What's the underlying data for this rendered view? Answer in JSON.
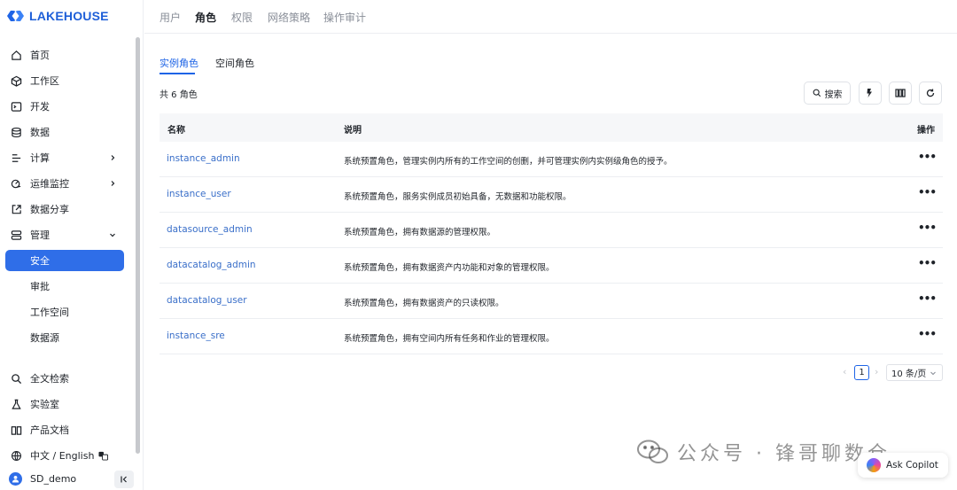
{
  "brand": {
    "name": "LAKEHOUSE"
  },
  "sidebar": {
    "items": [
      {
        "label": "首页",
        "icon": "home-icon"
      },
      {
        "label": "工作区",
        "icon": "cube-icon"
      },
      {
        "label": "开发",
        "icon": "terminal-icon"
      },
      {
        "label": "数据",
        "icon": "database-icon"
      },
      {
        "label": "计算",
        "icon": "compute-icon"
      },
      {
        "label": "运维监控",
        "icon": "monitor-icon"
      },
      {
        "label": "数据分享",
        "icon": "share-icon"
      },
      {
        "label": "管理",
        "icon": "manage-icon"
      },
      {
        "label": "安全"
      },
      {
        "label": "审批"
      },
      {
        "label": "工作空间"
      },
      {
        "label": "数据源"
      },
      {
        "label": "全文检索",
        "icon": "search-icon"
      },
      {
        "label": "实验室",
        "icon": "flask-icon"
      },
      {
        "label": "产品文档",
        "icon": "book-icon"
      },
      {
        "label": "中文 / English",
        "icon": "globe-icon"
      }
    ],
    "user": {
      "name": "SD_demo"
    }
  },
  "topnav": {
    "tabs": [
      "用户",
      "角色",
      "权限",
      "网络策略",
      "操作审计"
    ],
    "active": "角色"
  },
  "subtabs": {
    "tabs": [
      "实例角色",
      "空间角色"
    ],
    "active": "实例角色"
  },
  "summary": {
    "count_text": "共 6 角色"
  },
  "toolbar": {
    "search_label": "搜索"
  },
  "table": {
    "headers": [
      "名称",
      "说明",
      "操作"
    ],
    "rows": [
      {
        "name": "instance_admin",
        "desc": "系统预置角色，管理实例内所有的工作空间的创删，并可管理实例内实例级角色的授予。"
      },
      {
        "name": "instance_user",
        "desc": "系统预置角色，服务实例成员初始具备，无数据和功能权限。"
      },
      {
        "name": "datasource_admin",
        "desc": "系统预置角色，拥有数据源的管理权限。"
      },
      {
        "name": "datacatalog_admin",
        "desc": "系统预置角色，拥有数据资产内功能和对象的管理权限。"
      },
      {
        "name": "datacatalog_user",
        "desc": "系统预置角色，拥有数据资产的只读权限。"
      },
      {
        "name": "instance_sre",
        "desc": "系统预置角色，拥有空间内所有任务和作业的管理权限。"
      }
    ],
    "row_action": "•••"
  },
  "pagination": {
    "current": "1",
    "page_size": "10 条/页"
  },
  "watermark": {
    "text": "公众号 · 锋哥聊数仓"
  },
  "copilot": {
    "label": "Ask Copilot"
  },
  "colors": {
    "accent": "#2f6ee8",
    "link": "#3a6fc9"
  }
}
